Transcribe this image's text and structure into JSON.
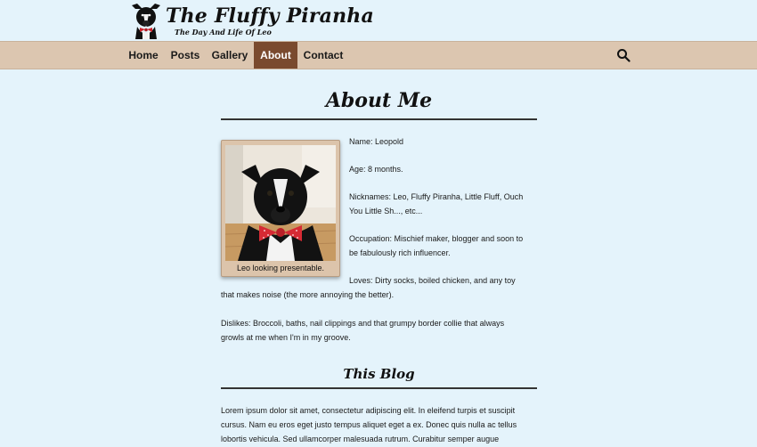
{
  "site": {
    "title": "The Fluffy Piranha",
    "tagline": "The Day And Life Of Leo"
  },
  "nav": {
    "items": [
      {
        "label": "Home"
      },
      {
        "label": "Posts"
      },
      {
        "label": "Gallery"
      },
      {
        "label": "About",
        "active": true
      },
      {
        "label": "Contact"
      }
    ],
    "search_icon": "search-icon"
  },
  "main": {
    "page_title": "About Me",
    "photo_caption": "Leo looking presentable.",
    "info": {
      "name": "Name: Leopold",
      "age": "Age: 8 months.",
      "nicknames_1": "Nicknames: Leo, Fluffy Piranha, Little Fluff, Ouch",
      "nicknames_2": "You Little Sh..., etc...",
      "occupation_1": "Occupation: Mischief maker, blogger and soon to",
      "occupation_2": "be fabulously rich influencer.",
      "loves_1": "Loves: Dirty socks, boiled chicken, and any toy",
      "loves_2": "that makes noise (the more annoying the better).",
      "dislikes_1": "Dislikes: Broccoli, baths, nail clippings and that grumpy border collie that always",
      "dislikes_2": "growls at me when I'm in my groove."
    },
    "blog_title": "This Blog",
    "blog_text": [
      "Lorem ipsum dolor sit amet, consectetur adipiscing elit. In eleifend turpis et suscipit",
      "cursus. Nam eu eros eget justo tempus aliquet eget a ex. Donec quis nulla ac tellus",
      "lobortis vehicula. Sed ullamcorper malesuada rutrum. Curabitur semper augue"
    ]
  },
  "colors": {
    "background": "#e4f3fb",
    "nav_bar": "#dcc6b0",
    "nav_active": "#7a4a2e",
    "photo_frame": "#dcc4ab"
  }
}
